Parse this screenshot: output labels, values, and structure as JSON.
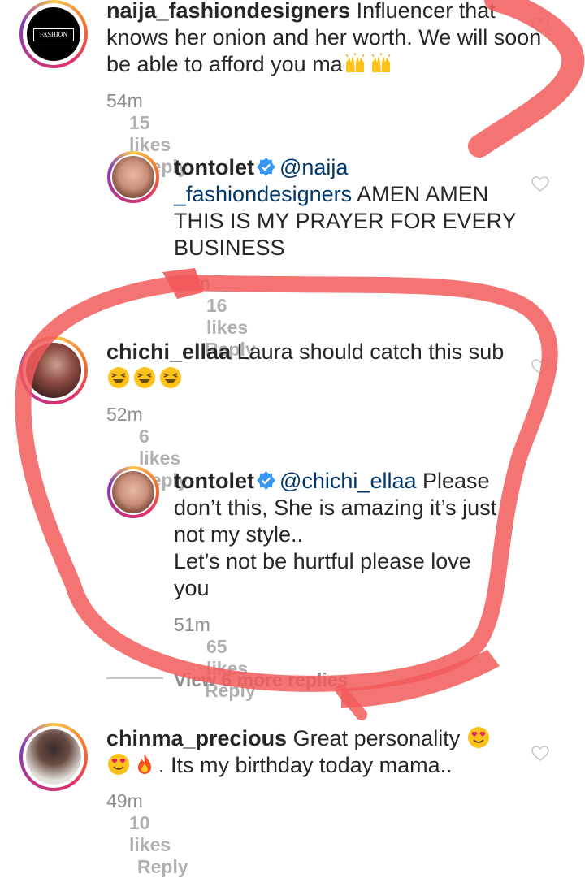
{
  "comments": [
    {
      "username": "naija_fashiondesigners",
      "text": "Influencer that knows her onion and her worth. We will soon be able to afford you ma",
      "avatar_text": "FASHION",
      "time": "54m",
      "likes": "15 likes",
      "reply": "Reply"
    },
    {
      "username": "tontolet",
      "mention": "@naija _fashiondesigners",
      "text": "AMEN AMEN THIS IS MY PRAYER FOR EVERY BUSINESS",
      "time": "51m",
      "likes": "16 likes",
      "reply": "Reply"
    },
    {
      "username": "chichi_ellaa",
      "text": "Laura should catch this sub",
      "time": "52m",
      "likes": "6 likes",
      "reply": "Reply"
    },
    {
      "username": "tontolet",
      "mention": "@chichi_ellaa",
      "text_line1": "Please",
      "text_line2": "don’t this, She is amazing it’s just",
      "text_line3": "not my style..",
      "text_line4": "Let’s not be hurtful please love",
      "text_line5": "you",
      "time": "51m",
      "likes": "65 likes",
      "reply": "Reply"
    },
    {
      "username": "chinma_precious",
      "text_line1": "Great personality",
      "text_line2": ". Its my birthday today mama..",
      "time": "49m",
      "likes": "10 likes",
      "reply": "Reply"
    }
  ],
  "view_more": "View 6 more replies",
  "colors": {
    "username": "#262626",
    "mention": "#00376b",
    "meta": "#8e8e8e",
    "annotation": "#f25a5a"
  },
  "icons": [
    "heart-outline-icon",
    "verified-badge-icon",
    "raising-hands-emoji",
    "laughing-emoji",
    "heart-eyes-emoji",
    "fire-emoji"
  ]
}
